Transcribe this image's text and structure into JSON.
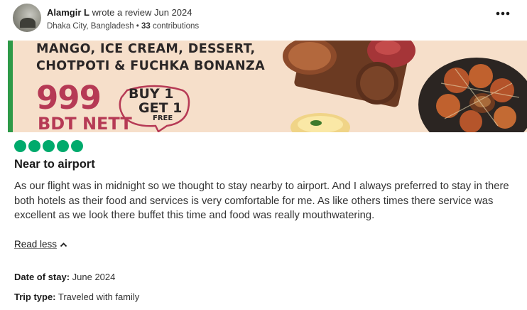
{
  "review": {
    "reviewer_name": "Alamgir L",
    "action_text": " wrote a review Jun 2024",
    "location": "Dhaka City, Bangladesh",
    "separator": " • ",
    "contributions": "33",
    "contributions_label": " contributions",
    "more_icon": "more-horizontal-icon",
    "rating_bubbles": 5,
    "title": "Near to airport",
    "body": "As our flight was in midnight so we thought to stay nearby to airport. And I always preferred to stay in there both hotels as their food and services is very comfortable for me. As like others times there service was excellent as we look there buffet this time and food was really mouthwatering.",
    "read_less_label": "Read less",
    "read_less_icon": "chevron-up-icon",
    "date_of_stay_label": "Date of stay:",
    "date_of_stay_value": " June 2024",
    "trip_type_label": "Trip type:",
    "trip_type_value": " Traveled with family"
  },
  "banner": {
    "headline_line1": "MANGO, ICE CREAM, DESSERT,",
    "headline_line2": "CHOTPOTI & FUCHKA BONANZA",
    "price": "999",
    "price_unit": "BDT NETT",
    "bogo_line1": "BUY 1",
    "bogo_line2": "GET 1",
    "bogo_line3": "FREE"
  },
  "colors": {
    "rating_green": "#00aa6c",
    "banner_background": "#f6dfca",
    "banner_accent_bar": "#2e9a48",
    "price_red": "#b63a55"
  }
}
